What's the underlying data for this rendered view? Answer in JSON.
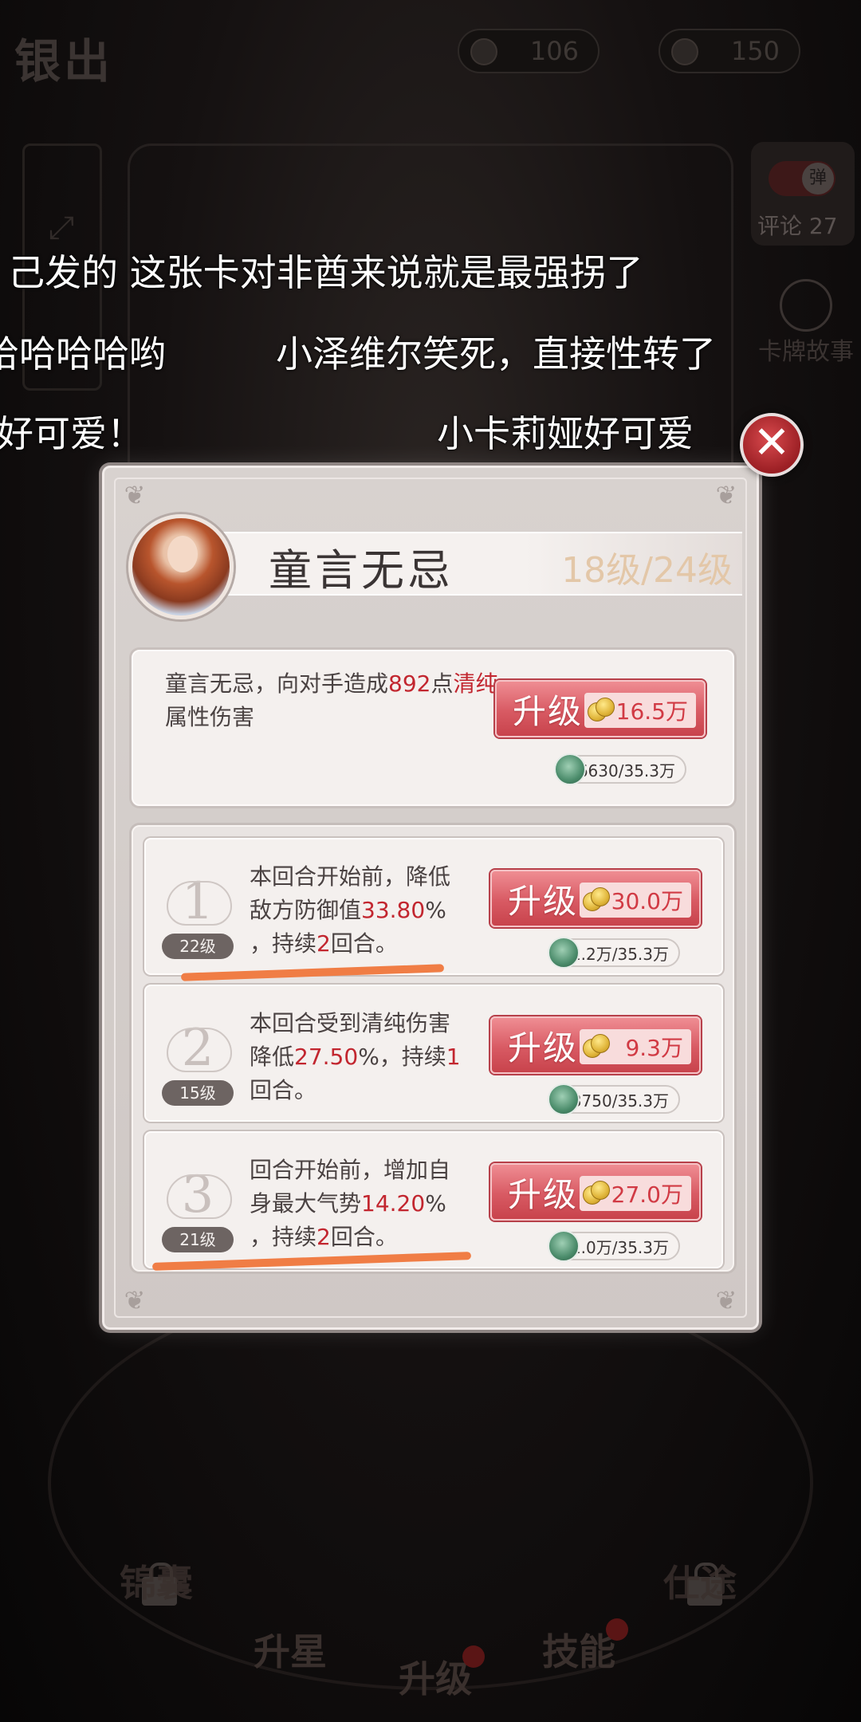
{
  "header": {
    "logo_text": "银出",
    "currency_1": "106",
    "currency_2": "150"
  },
  "side": {
    "danmu_toggle_label": "弹",
    "comment_label": "评论 27",
    "story_label": "卡牌故事"
  },
  "danmaku": [
    "己发的 这张卡对非酋来说就是最强拐了",
    "哈哈哈哈哟",
    "小泽维尔笑死，直接性转了",
    "好可爱！",
    "小卡莉娅好可爱"
  ],
  "panel": {
    "skill_name": "童言无忌",
    "level_text": "18级/24级",
    "main": {
      "desc_parts": [
        "童言无忌，向对手造成",
        "892",
        "点",
        "清纯",
        "属性伤害"
      ],
      "upgrade_label": "升级",
      "cost": "16.5万",
      "material": "6630/35.3万"
    },
    "subs": [
      {
        "num": "1",
        "level": "22级",
        "line1": "本回合开始前，降低",
        "line2a": "敌方防御值",
        "line2b": "33.80",
        "line2c": "%",
        "line3a": "，持续",
        "line3b": "2",
        "line3c": "回合。",
        "upgrade_label": "升级",
        "cost": "30.0万",
        "material": "1.2万/35.3万"
      },
      {
        "num": "2",
        "level": "15级",
        "line1": "本回合受到清纯伤害",
        "line2a": "降低",
        "line2b": "27.50",
        "line2c": "%，持续",
        "line2d": "1",
        "line3a": "回合。",
        "upgrade_label": "升级",
        "cost": "9.3万",
        "material": "3750/35.3万"
      },
      {
        "num": "3",
        "level": "21级",
        "line1": "回合开始前，增加自",
        "line2a": "身最大气势",
        "line2b": "14.20",
        "line2c": "%",
        "line3a": "，持续",
        "line3b": "2",
        "line3c": "回合。",
        "upgrade_label": "升级",
        "cost": "27.0万",
        "material": "1.0万/35.3万"
      }
    ]
  },
  "bottom_nav": {
    "lock_left": "锦囊",
    "star": "升星",
    "upgrade": "升级",
    "skill": "技能",
    "lock_right": "仕途"
  },
  "colors": {
    "highlight": "#c2262f",
    "button": "#d85a63",
    "annotation": "#f07d45"
  }
}
